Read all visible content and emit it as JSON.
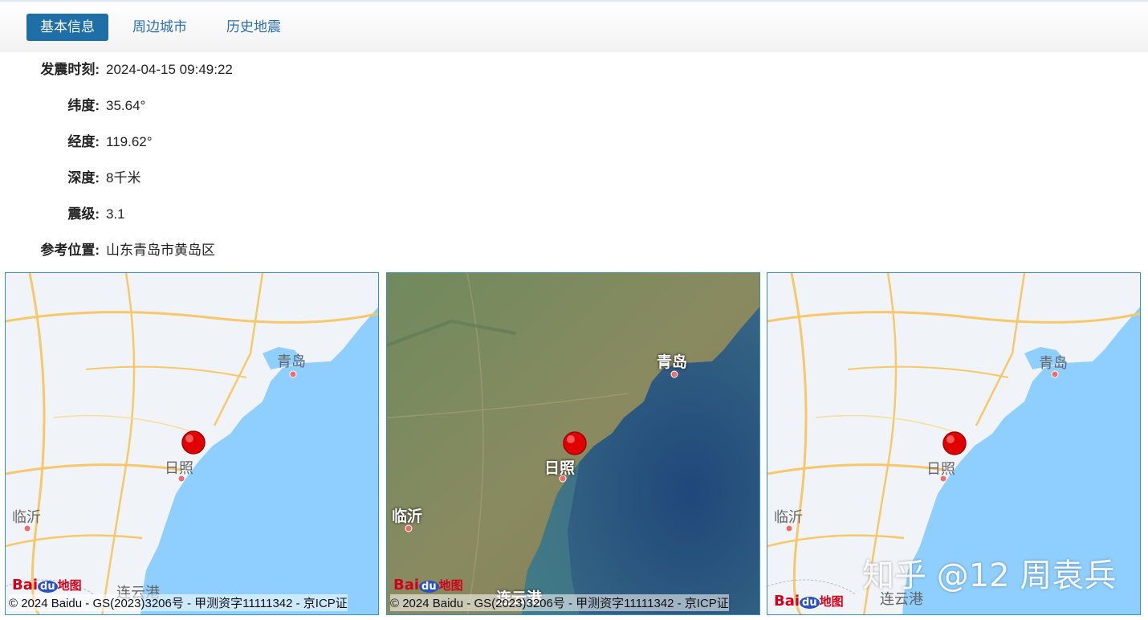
{
  "tabs": [
    {
      "label": "基本信息",
      "active": true
    },
    {
      "label": "周边城市",
      "active": false
    },
    {
      "label": "历史地震",
      "active": false
    }
  ],
  "info": [
    {
      "label": "发震时刻:",
      "value": "2024-04-15 09:49:22"
    },
    {
      "label": "纬度:",
      "value": "35.64°"
    },
    {
      "label": "经度:",
      "value": "119.62°"
    },
    {
      "label": "深度:",
      "value": "8千米"
    },
    {
      "label": "震级:",
      "value": "3.1"
    },
    {
      "label": "参考位置:",
      "value": "山东青岛市黄岛区"
    }
  ],
  "maps": {
    "copyright": "© 2024 Baidu - GS(2023)3206号 - 甲测资字11111342 - 京ICP证",
    "logo": {
      "bai": "Bai",
      "du": "du",
      "ditu": "地图"
    },
    "cities": {
      "qingdao": "青岛",
      "rizhao": "日照",
      "linyi": "临沂",
      "lianyungang": "连云港"
    }
  },
  "watermark": "知乎 @12 周袁兵",
  "colors": {
    "tab_active": "#1e6fa6",
    "tab_link": "#2a6fb0",
    "sea": "#8ecfff",
    "land": "#f0f3f8",
    "road": "#f7c86a",
    "marker": "#e00000",
    "panel_border": "#3a8fc2"
  }
}
